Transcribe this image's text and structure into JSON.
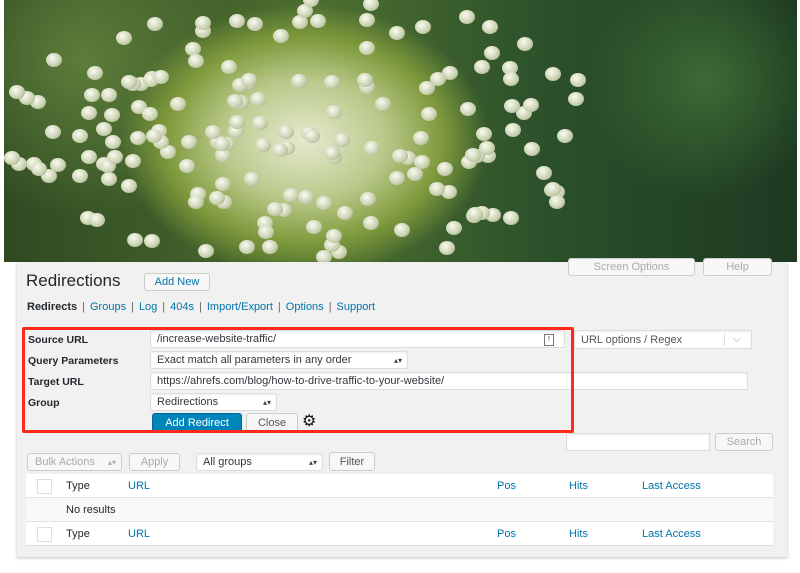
{
  "header": {
    "title": "Redirections",
    "add_new": "Add New",
    "screen_options": "Screen Options",
    "help": "Help"
  },
  "nav": {
    "items": [
      "Redirects",
      "Groups",
      "Log",
      "404s",
      "Import/Export",
      "Options",
      "Support"
    ]
  },
  "form": {
    "source_url_label": "Source URL",
    "source_url_value": "/increase-website-traffic/",
    "url_options": "URL options / Regex",
    "query_label": "Query Parameters",
    "query_value": "Exact match all parameters in any order",
    "target_label": "Target URL",
    "target_value": "https://ahrefs.com/blog/how-to-drive-traffic-to-your-website/",
    "group_label": "Group",
    "group_value": "Redirections",
    "add_redirect": "Add Redirect",
    "close": "Close"
  },
  "colors": {
    "highlight_border": "#ff2a1a",
    "primary": "#0085ba",
    "link": "#0073aa"
  },
  "search": {
    "button": "Search",
    "value": ""
  },
  "toolbar": {
    "bulk_actions": "Bulk Actions",
    "apply": "Apply",
    "groups": "All groups",
    "filter": "Filter"
  },
  "table": {
    "columns": [
      "Type",
      "URL",
      "Pos",
      "Hits",
      "Last Access"
    ],
    "empty": "No results"
  }
}
